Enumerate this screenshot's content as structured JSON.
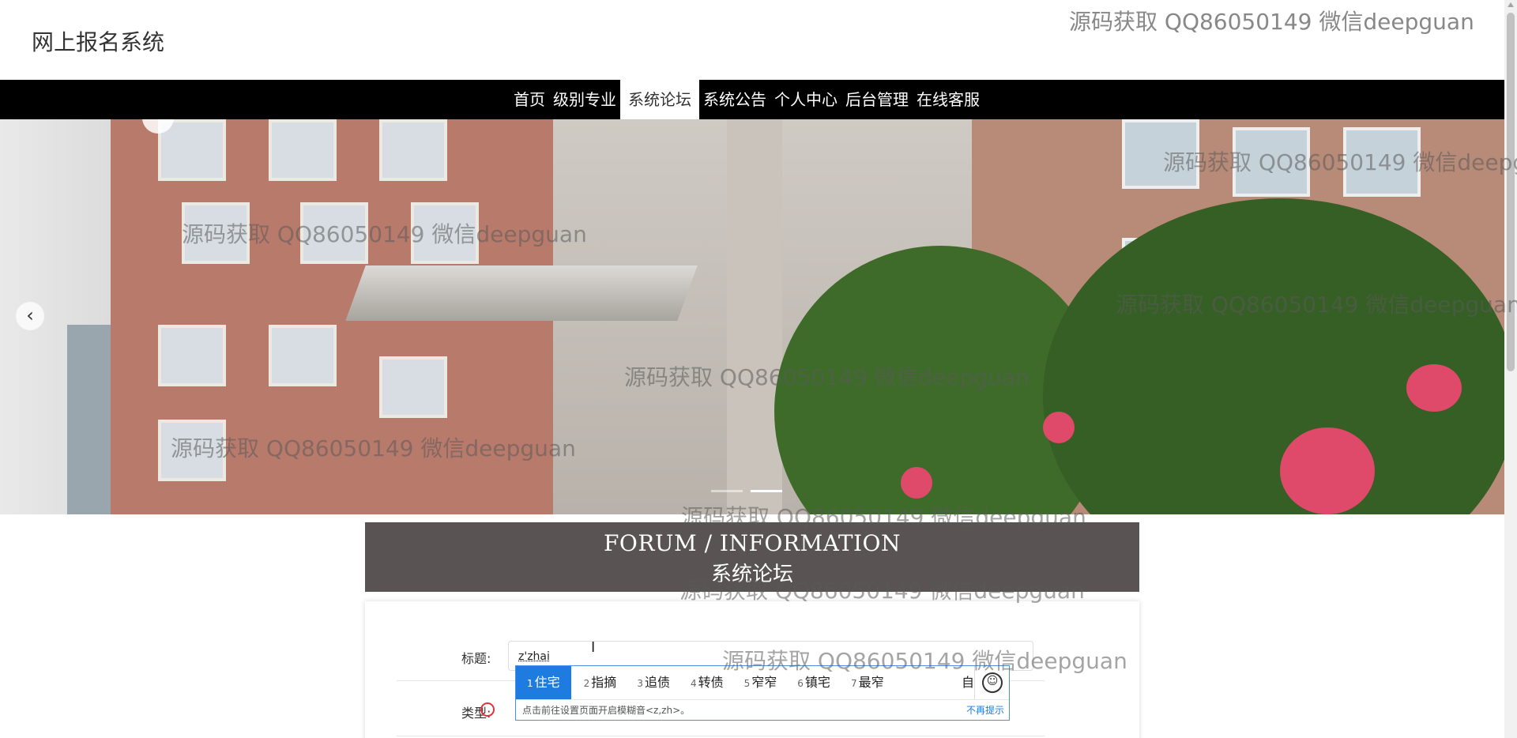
{
  "site": {
    "title": "网上报名系统"
  },
  "nav": {
    "items": [
      "首页",
      "级别专业",
      "系统论坛",
      "系统公告",
      "个人中心",
      "后台管理",
      "在线客服"
    ],
    "active_index": 2
  },
  "banner": {
    "prev_label": "‹",
    "slides": 2,
    "active_slide": 1
  },
  "forum": {
    "title_en": "FORUM / INFORMATION",
    "title_cn": "系统论坛"
  },
  "form": {
    "title_label": "标题:",
    "title_value": "z'zhai",
    "type_label": "类型:"
  },
  "ime": {
    "candidates": [
      {
        "n": "1",
        "text": "住宅"
      },
      {
        "n": "2",
        "text": "指摘"
      },
      {
        "n": "3",
        "text": "追债"
      },
      {
        "n": "4",
        "text": "转债"
      },
      {
        "n": "5",
        "text": "窄窄"
      },
      {
        "n": "6",
        "text": "镇宅"
      },
      {
        "n": "7",
        "text": "最窄"
      }
    ],
    "more": "自",
    "tip": "点击前往设置页面开启模糊音<z,zh>。",
    "dismiss": "不再提示"
  },
  "watermark": "源码获取 QQ86050149 微信deepguan"
}
